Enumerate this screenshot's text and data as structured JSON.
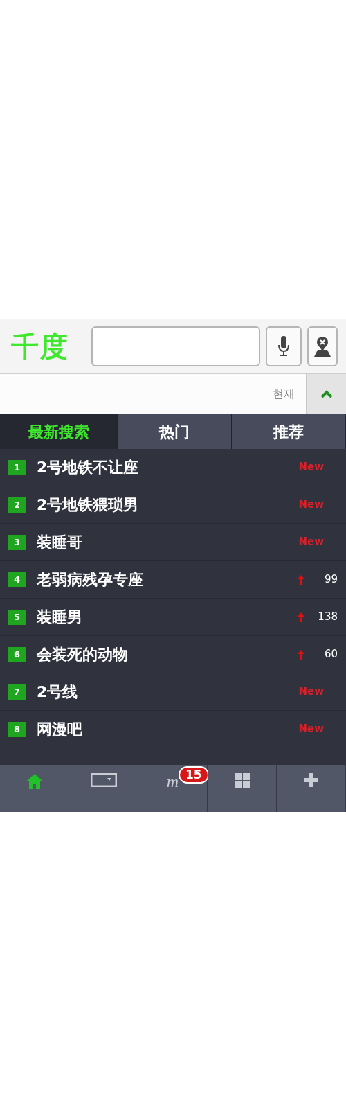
{
  "header": {
    "logo": "千度"
  },
  "subbar": {
    "label": "현재",
    "expanded": true
  },
  "tabs": [
    {
      "label": "最新搜索",
      "selected": true
    },
    {
      "label": "热门",
      "selected": false
    },
    {
      "label": "推荐",
      "selected": false
    }
  ],
  "rows": [
    {
      "rank": "1",
      "title": "2号地铁不让座",
      "kind": "new",
      "badge": "New"
    },
    {
      "rank": "2",
      "title": "2号地铁猥琐男",
      "kind": "new",
      "badge": "New"
    },
    {
      "rank": "3",
      "title": "装睡哥",
      "kind": "new",
      "badge": "New"
    },
    {
      "rank": "4",
      "title": "老弱病残孕专座",
      "kind": "rising",
      "count": "99"
    },
    {
      "rank": "5",
      "title": "装睡男",
      "kind": "rising",
      "count": "138"
    },
    {
      "rank": "6",
      "title": "会装死的动物",
      "kind": "rising",
      "count": "60"
    },
    {
      "rank": "7",
      "title": "2号线",
      "kind": "new",
      "badge": "New"
    },
    {
      "rank": "8",
      "title": "网漫吧",
      "kind": "new",
      "badge": "New"
    }
  ],
  "nav": [
    {
      "kind": "home",
      "selected": true
    },
    {
      "kind": "window",
      "selected": false
    },
    {
      "kind": "me",
      "label": "m",
      "badge": "15",
      "selected": false
    },
    {
      "kind": "grid",
      "selected": false
    },
    {
      "kind": "plus",
      "selected": false
    }
  ]
}
